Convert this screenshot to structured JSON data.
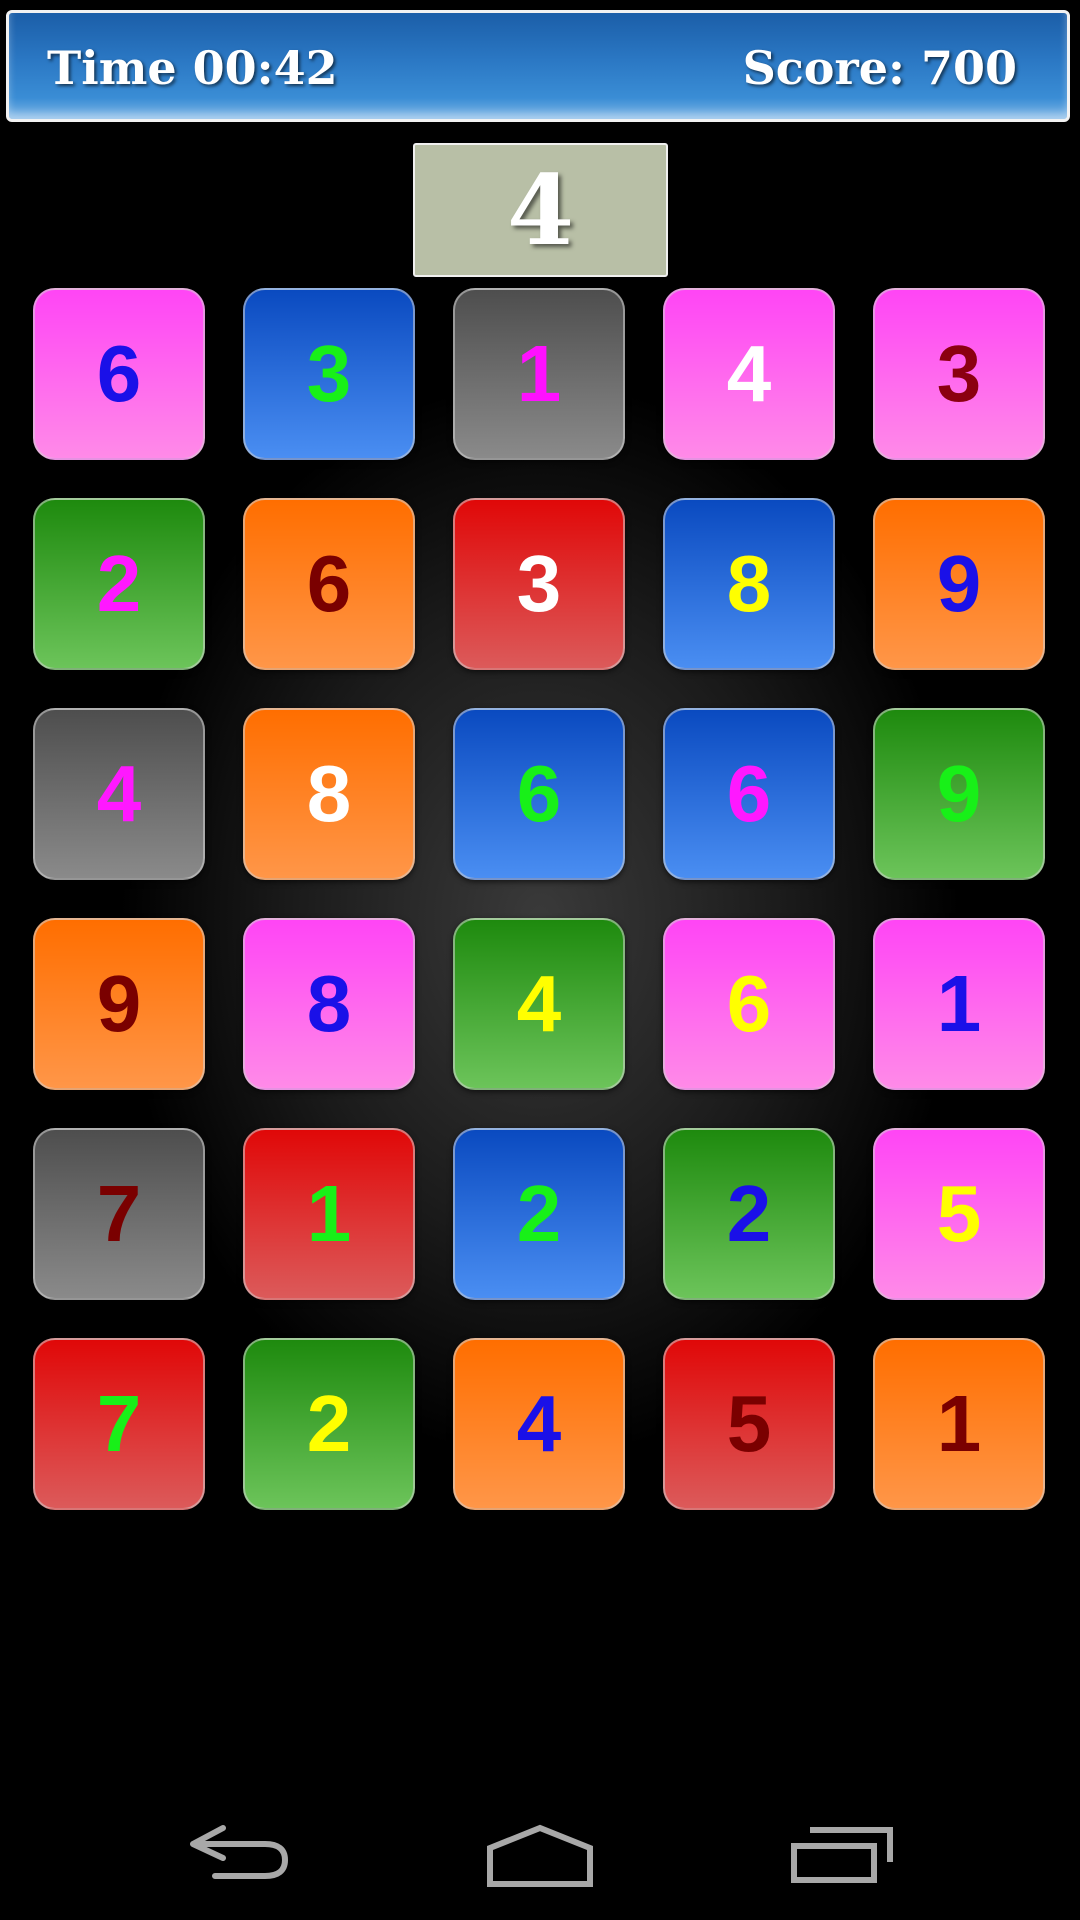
{
  "header": {
    "time_text": "Time 00:42",
    "score_text": "Score: 700"
  },
  "target": {
    "value": "4"
  },
  "board": {
    "rows": [
      [
        {
          "value": "6",
          "bg": "pink",
          "color": "#1a10e8"
        },
        {
          "value": "3",
          "bg": "blue",
          "color": "#18f018"
        },
        {
          "value": "1",
          "bg": "gray",
          "color": "#ff10ff"
        },
        {
          "value": "4",
          "bg": "pink",
          "color": "#ffffff"
        },
        {
          "value": "3",
          "bg": "pink",
          "color": "#8b0010"
        }
      ],
      [
        {
          "value": "2",
          "bg": "green",
          "color": "#ff18ff"
        },
        {
          "value": "6",
          "bg": "orange",
          "color": "#7a0000"
        },
        {
          "value": "3",
          "bg": "red",
          "color": "#ffffff"
        },
        {
          "value": "8",
          "bg": "blue",
          "color": "#ffff00"
        },
        {
          "value": "9",
          "bg": "orange",
          "color": "#1a10e8"
        }
      ],
      [
        {
          "value": "4",
          "bg": "gray",
          "color": "#ff18ff"
        },
        {
          "value": "8",
          "bg": "orange",
          "color": "#ffffff"
        },
        {
          "value": "6",
          "bg": "blue",
          "color": "#18f018"
        },
        {
          "value": "6",
          "bg": "blue",
          "color": "#ff18ff"
        },
        {
          "value": "9",
          "bg": "green",
          "color": "#18f018"
        }
      ],
      [
        {
          "value": "9",
          "bg": "orange",
          "color": "#7a0000"
        },
        {
          "value": "8",
          "bg": "pink",
          "color": "#1a10e8"
        },
        {
          "value": "4",
          "bg": "green",
          "color": "#ffff00"
        },
        {
          "value": "6",
          "bg": "pink",
          "color": "#ffff00"
        },
        {
          "value": "1",
          "bg": "pink",
          "color": "#1a10e8"
        }
      ],
      [
        {
          "value": "7",
          "bg": "gray",
          "color": "#7a0000"
        },
        {
          "value": "1",
          "bg": "red",
          "color": "#18f018"
        },
        {
          "value": "2",
          "bg": "blue",
          "color": "#18f018"
        },
        {
          "value": "2",
          "bg": "green",
          "color": "#1a10e8"
        },
        {
          "value": "5",
          "bg": "pink",
          "color": "#ffff00"
        }
      ],
      [
        {
          "value": "7",
          "bg": "red",
          "color": "#18f018"
        },
        {
          "value": "2",
          "bg": "green",
          "color": "#ffff00"
        },
        {
          "value": "4",
          "bg": "orange",
          "color": "#1a10e8"
        },
        {
          "value": "5",
          "bg": "red",
          "color": "#7a0000"
        },
        {
          "value": "1",
          "bg": "orange",
          "color": "#7a0000"
        }
      ]
    ]
  },
  "navbar": {
    "icons": [
      "back-icon",
      "home-icon",
      "recent-apps-icon"
    ]
  }
}
